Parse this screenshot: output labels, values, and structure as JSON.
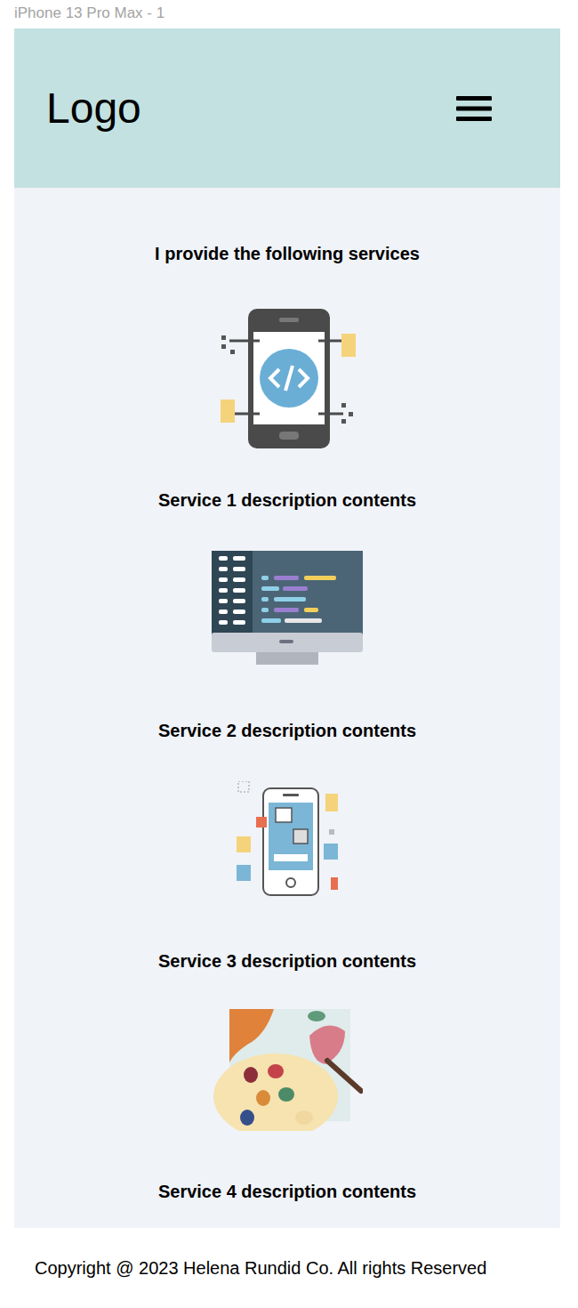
{
  "frame": {
    "title": "iPhone 13 Pro Max - 1"
  },
  "header": {
    "logo": "Logo"
  },
  "services": {
    "heading": "I provide the following services",
    "items": [
      {
        "kind": "mobile-dev",
        "description": "Service 1 description contents"
      },
      {
        "kind": "web-code",
        "description": "Service 2 description contents"
      },
      {
        "kind": "mobile-app",
        "description": "Service 3 description contents"
      },
      {
        "kind": "design",
        "description": "Service 4 description contents"
      }
    ]
  },
  "footer": {
    "copyright": "Copyright @ 2023 Helena Rundid Co. All rights Reserved"
  }
}
